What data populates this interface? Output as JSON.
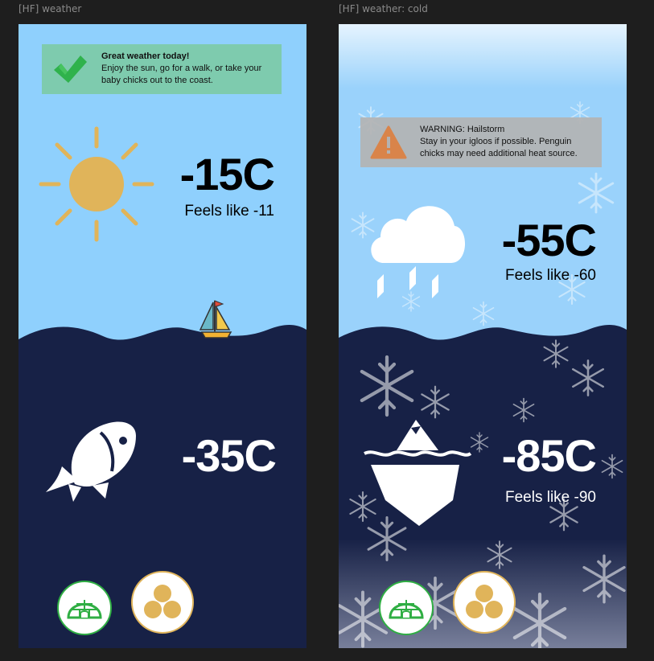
{
  "canvas": {
    "frame_1_title": "[HF] weather",
    "frame_2_title": "[HF] weather: cold"
  },
  "weather": {
    "banner": {
      "title": "Great weather today!",
      "body": "Enjoy the sun, go for a walk, or take your baby chicks out to the coast."
    },
    "air_temp": "-15C",
    "air_feels_like": "Feels like -11",
    "water_temp": "-35C",
    "sky_icon": "sun-icon",
    "water_icon": "fish-icon",
    "nav": [
      "igloo-icon",
      "eggs-icon"
    ]
  },
  "cold": {
    "banner": {
      "title": "WARNING: Hailstorm",
      "body": "Stay in your igloos if possible. Penguin chicks may need additional heat source."
    },
    "air_temp": "-55C",
    "air_feels_like": "Feels like -60",
    "water_temp": "-85C",
    "water_feels_like": "Feels like -90",
    "sky_icon": "hail-cloud-icon",
    "water_icon": "iceberg-icon",
    "nav": [
      "igloo-icon",
      "eggs-icon"
    ]
  },
  "colors": {
    "sky": "#8fd0fd",
    "sea": "#172146",
    "sun": "#e0b45a",
    "success_banner": "#7ecbae",
    "warning_banner": "#b3b3b3",
    "warning_icon": "#d9844a",
    "igloo_green": "#2fae43"
  }
}
